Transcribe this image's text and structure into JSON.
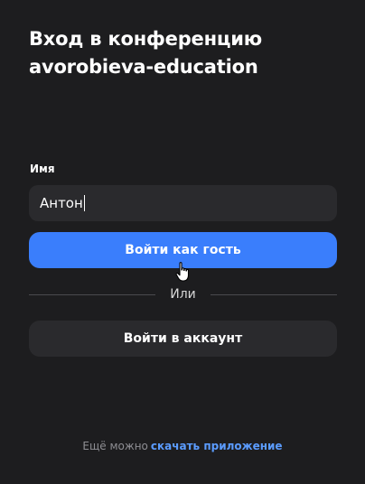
{
  "dialog": {
    "title_line1": "Вход в конференцию",
    "title_line2": "avorobieva-education"
  },
  "name_field": {
    "label": "Имя",
    "value": "Антон"
  },
  "buttons": {
    "guest_label": "Войти как гость",
    "account_label": "Войти в аккаунт"
  },
  "divider": {
    "label": "Или"
  },
  "footer": {
    "text": "Ещё можно",
    "link_label": "скачать приложение"
  },
  "colors": {
    "background": "#1d1d1f",
    "accent": "#3a7efc",
    "link": "#5b9cff",
    "field": "#2a2a2d"
  },
  "icons": {
    "cursor": "hand-pointer-icon"
  }
}
